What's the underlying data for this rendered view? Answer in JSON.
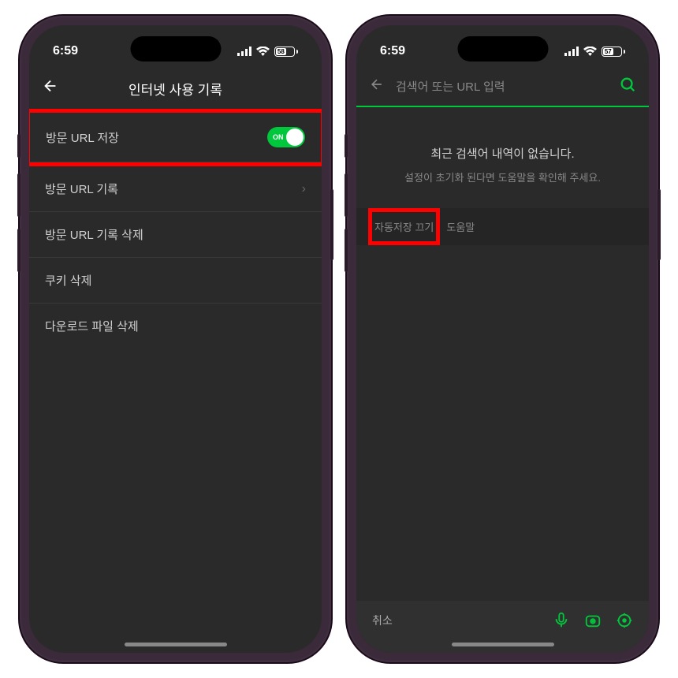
{
  "phone1": {
    "status": {
      "time": "6:59",
      "battery": "58"
    },
    "header": {
      "title": "인터넷 사용 기록"
    },
    "items": [
      {
        "label": "방문 URL 저장",
        "toggle_text": "ON"
      },
      {
        "label": "방문 URL 기록"
      },
      {
        "label": "방문 URL 기록 삭제"
      },
      {
        "label": "쿠키 삭제"
      },
      {
        "label": "다운로드 파일 삭제"
      }
    ]
  },
  "phone2": {
    "status": {
      "time": "6:59",
      "battery": "57"
    },
    "search": {
      "placeholder": "검색어 또는 URL 입력"
    },
    "empty": {
      "title": "최근 검색어 내역이 없습니다.",
      "sub": "설정이 초기화 된다면 도움말을 확인해 주세요."
    },
    "actions": {
      "autosave_off": "자동저장 끄기",
      "help": "도움말"
    },
    "bottom": {
      "cancel": "취소"
    }
  }
}
